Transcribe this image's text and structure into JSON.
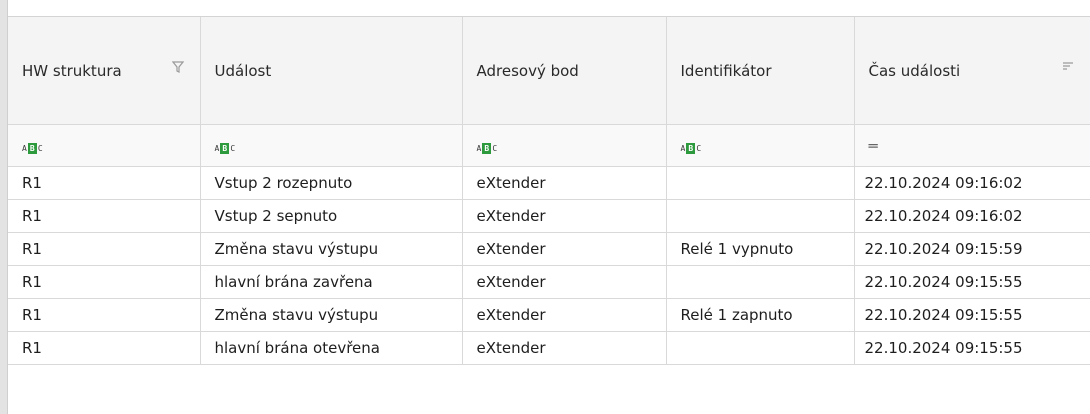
{
  "columns": [
    {
      "label": "HW struktura",
      "icon": "filter-funnel-icon"
    },
    {
      "label": "Událost"
    },
    {
      "label": "Adresový bod"
    },
    {
      "label": "Identifikátor"
    },
    {
      "label": "Čas události",
      "icon": "sort-lines-icon"
    }
  ],
  "filter_row": {
    "text_filter_icon": "abc-filter-icon",
    "equals_filter_icon": "equals-filter-icon"
  },
  "rows": [
    {
      "hw": "R1",
      "event": "Vstup 2 rozepnuto",
      "address": "eXtender",
      "identifier": "",
      "time": "22.10.2024 09:16:02"
    },
    {
      "hw": "R1",
      "event": "Vstup 2 sepnuto",
      "address": "eXtender",
      "identifier": "",
      "time": "22.10.2024 09:16:02"
    },
    {
      "hw": "R1",
      "event": "Změna stavu výstupu",
      "address": "eXtender",
      "identifier": "Relé 1 vypnuto",
      "time": "22.10.2024 09:15:59"
    },
    {
      "hw": "R1",
      "event": "hlavní brána zavřena",
      "address": "eXtender",
      "identifier": "",
      "time": "22.10.2024 09:15:55"
    },
    {
      "hw": "R1",
      "event": "Změna stavu výstupu",
      "address": "eXtender",
      "identifier": "Relé 1 zapnuto",
      "time": "22.10.2024 09:15:55"
    },
    {
      "hw": "R1",
      "event": "hlavní brána otevřena",
      "address": "eXtender",
      "identifier": "",
      "time": "22.10.2024 09:15:55"
    }
  ]
}
